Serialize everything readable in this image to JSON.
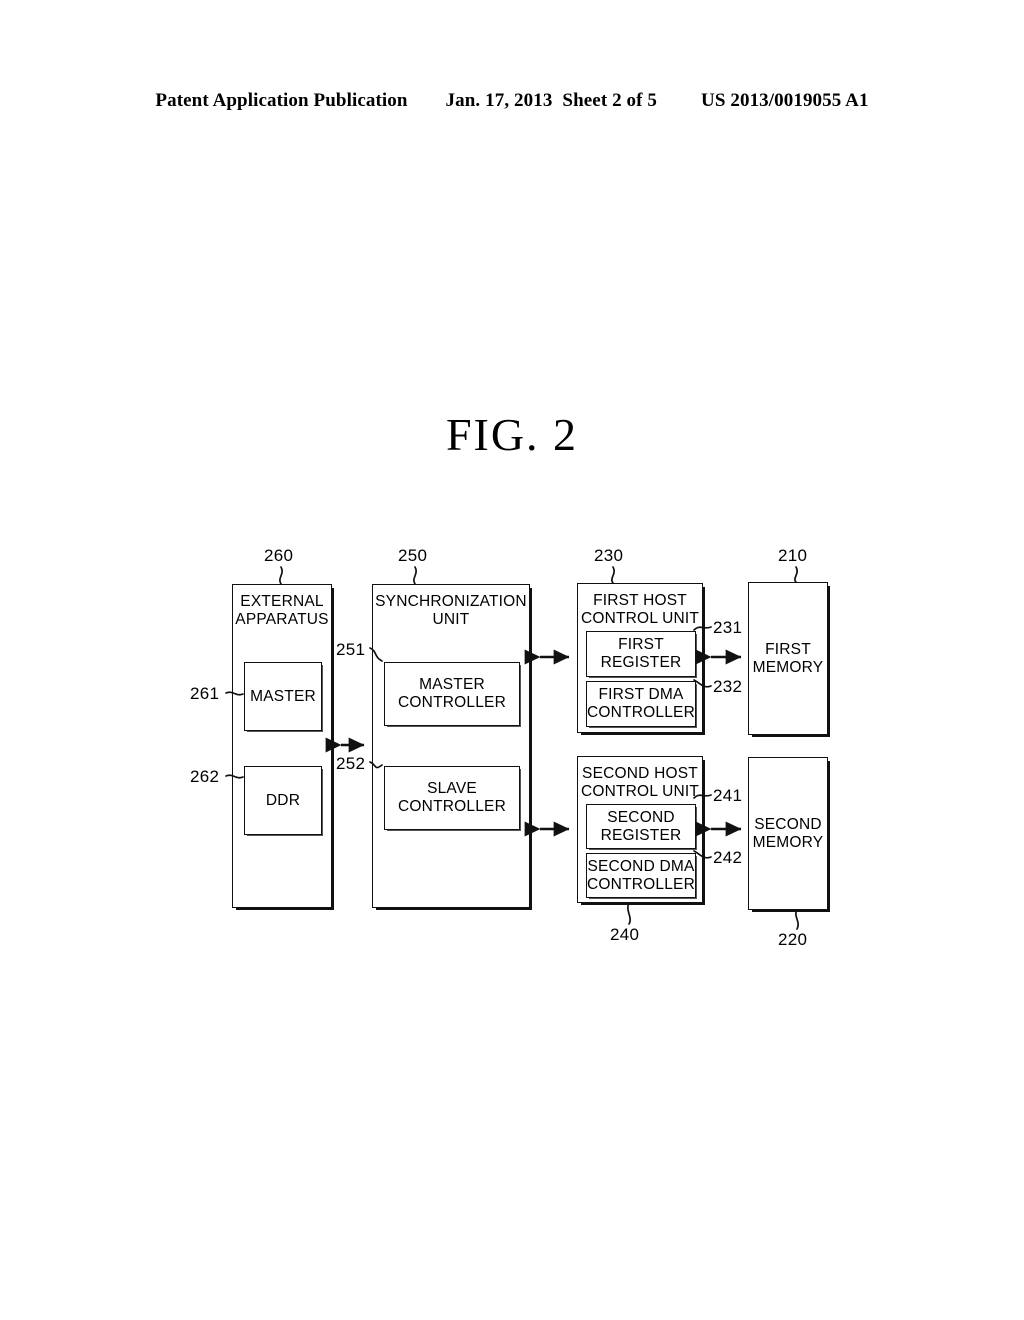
{
  "header": {
    "publication": "Patent Application Publication",
    "date": "Jan. 17, 2013",
    "sheet": "Sheet 2 of 5",
    "number": "US 2013/0019055 A1"
  },
  "figure": {
    "title": "FIG.  2"
  },
  "blocks": {
    "external_apparatus": {
      "label": "EXTERNAL\nAPPARATUS",
      "ref": "260",
      "children": [
        {
          "label": "MASTER",
          "ref": "261"
        },
        {
          "label": "DDR",
          "ref": "262"
        }
      ]
    },
    "synchronization_unit": {
      "label": "SYNCHRONIZATION\nUNIT",
      "ref": "250",
      "children": [
        {
          "label": "MASTER\nCONTROLLER",
          "ref": "251"
        },
        {
          "label": "SLAVE\nCONTROLLER",
          "ref": "252"
        }
      ]
    },
    "first_host_control_unit": {
      "label": "FIRST HOST\nCONTROL UNIT",
      "ref": "230",
      "children": [
        {
          "label": "FIRST\nREGISTER",
          "ref": "231"
        },
        {
          "label": "FIRST DMA\nCONTROLLER",
          "ref": "232"
        }
      ]
    },
    "second_host_control_unit": {
      "label": "SECOND HOST\nCONTROL UNIT",
      "ref": "240",
      "children": [
        {
          "label": "SECOND\nREGISTER",
          "ref": "241"
        },
        {
          "label": "SECOND DMA\nCONTROLLER",
          "ref": "242"
        }
      ]
    },
    "first_memory": {
      "label": "FIRST\nMEMORY",
      "ref": "210"
    },
    "second_memory": {
      "label": "SECOND\nMEMORY",
      "ref": "220"
    }
  },
  "connections": [
    {
      "name": "external-apparatus-to-synchronization-unit",
      "type": "bidirectional"
    },
    {
      "name": "synchronization-unit-to-first-host-control-unit",
      "type": "bidirectional"
    },
    {
      "name": "synchronization-unit-to-second-host-control-unit",
      "type": "bidirectional"
    },
    {
      "name": "first-host-control-unit-to-first-memory",
      "type": "bidirectional"
    },
    {
      "name": "second-host-control-unit-to-second-memory",
      "type": "bidirectional"
    }
  ],
  "colors": {
    "ink": "#111111",
    "paper": "#ffffff"
  }
}
